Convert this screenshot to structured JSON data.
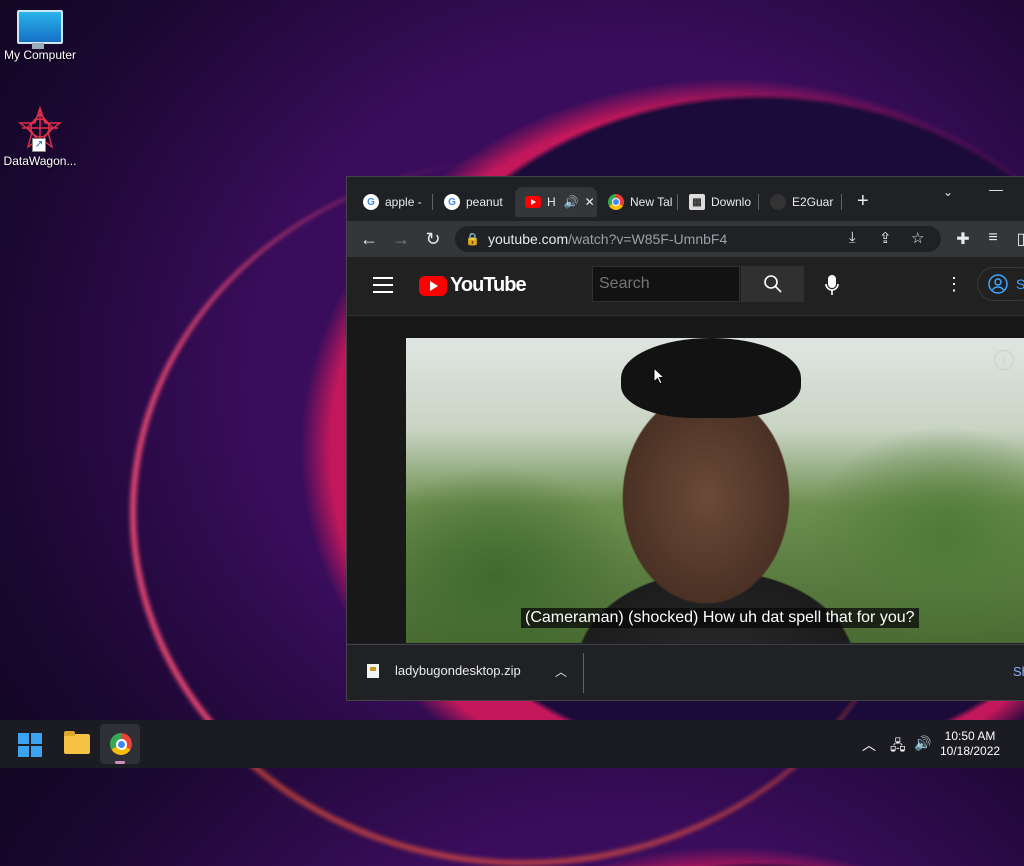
{
  "desktop": {
    "icons": [
      {
        "label": "My Computer"
      },
      {
        "label": "DataWagon..."
      }
    ]
  },
  "browser": {
    "tabs": [
      {
        "label": "apple -",
        "favicon": "google-icon"
      },
      {
        "label": "peanut",
        "favicon": "google-icon"
      },
      {
        "label": "H",
        "favicon": "youtube-icon",
        "active": true,
        "audio": "🔊"
      },
      {
        "label": "New Tal",
        "favicon": "chrome-icon"
      },
      {
        "label": "Downlo",
        "favicon": "download-icon"
      },
      {
        "label": "E2Guar",
        "favicon": "e2guardian-icon"
      }
    ],
    "new_tab": "+",
    "close_glyph": "✕",
    "tab_search": "⌄",
    "minimize": "—",
    "url_host": "youtube.com",
    "url_path": "/watch?v=W85F-UmnbF4"
  },
  "youtube": {
    "logo_text": "YouTube",
    "search_placeholder": "Search",
    "signin_label": "S",
    "caption": "(Cameraman) (shocked) How uh dat spell that for you?",
    "info_glyph": "i"
  },
  "download_bar": {
    "file_name": "ladybugondesktop.zip",
    "show_all": "Sh"
  },
  "taskbar": {
    "time": "10:50 AM",
    "date": "10/18/2022"
  },
  "colors": {
    "accent_red": "#ff0000",
    "link_blue": "#3ea6ff"
  }
}
